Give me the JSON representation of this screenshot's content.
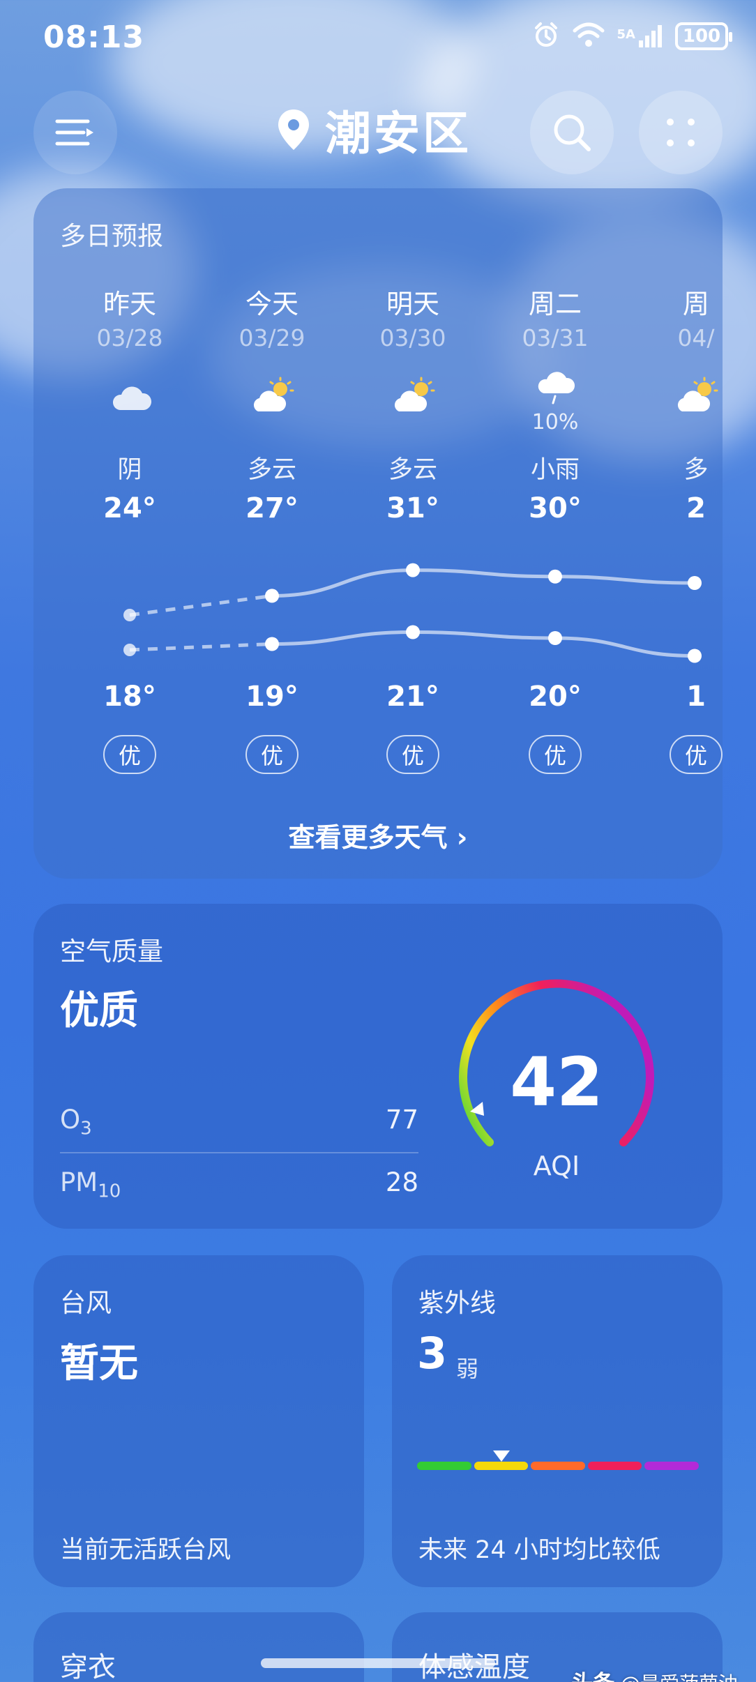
{
  "status_bar": {
    "time": "08:13",
    "network_label": "5A",
    "battery": "100"
  },
  "header": {
    "location": "潮安区",
    "icons": [
      "menu-icon",
      "location-pin-icon",
      "search-icon",
      "grid-more-icon"
    ]
  },
  "forecast": {
    "title": "多日预报",
    "days": [
      {
        "name": "昨天",
        "date": "03/28",
        "icon": "cloudy-icon",
        "precip": "",
        "condition": "阴",
        "high": "24°",
        "low": "18°",
        "aqi": "优"
      },
      {
        "name": "今天",
        "date": "03/29",
        "icon": "partly-cloudy-icon",
        "precip": "",
        "condition": "多云",
        "high": "27°",
        "low": "19°",
        "aqi": "优"
      },
      {
        "name": "明天",
        "date": "03/30",
        "icon": "partly-cloudy-icon",
        "precip": "",
        "condition": "多云",
        "high": "31°",
        "low": "21°",
        "aqi": "优"
      },
      {
        "name": "周二",
        "date": "03/31",
        "icon": "light-rain-icon",
        "precip": "10%",
        "condition": "小雨",
        "high": "30°",
        "low": "20°",
        "aqi": "优"
      },
      {
        "name": "周",
        "date": "04/",
        "icon": "partly-cloudy-icon",
        "precip": "",
        "condition": "多",
        "high": "2",
        "low": "1",
        "aqi": "优"
      }
    ],
    "more_link": "查看更多天气"
  },
  "air_quality": {
    "title": "空气质量",
    "status": "优质",
    "pollutants": [
      {
        "name": "O",
        "sub": "3",
        "value": "77"
      },
      {
        "name": "PM",
        "sub": "10",
        "value": "28"
      }
    ],
    "aqi_value": "42",
    "aqi_label": "AQI",
    "aqi_fraction": 0.08
  },
  "typhoon": {
    "title": "台风",
    "value": "暂无",
    "footer": "当前无活跃台风"
  },
  "uv": {
    "title": "紫外线",
    "value": "3",
    "level": "弱",
    "footer": "未来 24 小时均比较低",
    "scale_colors": [
      "#33cc33",
      "#f5d90a",
      "#ff6a2a",
      "#f0205a",
      "#b32ad8"
    ],
    "marker_level": 0.3
  },
  "bottom_cards": {
    "dressing_title": "穿衣",
    "feels_title": "体感温度"
  },
  "watermark": {
    "brand": "头条",
    "handle": "@最爱菠萝油"
  }
}
